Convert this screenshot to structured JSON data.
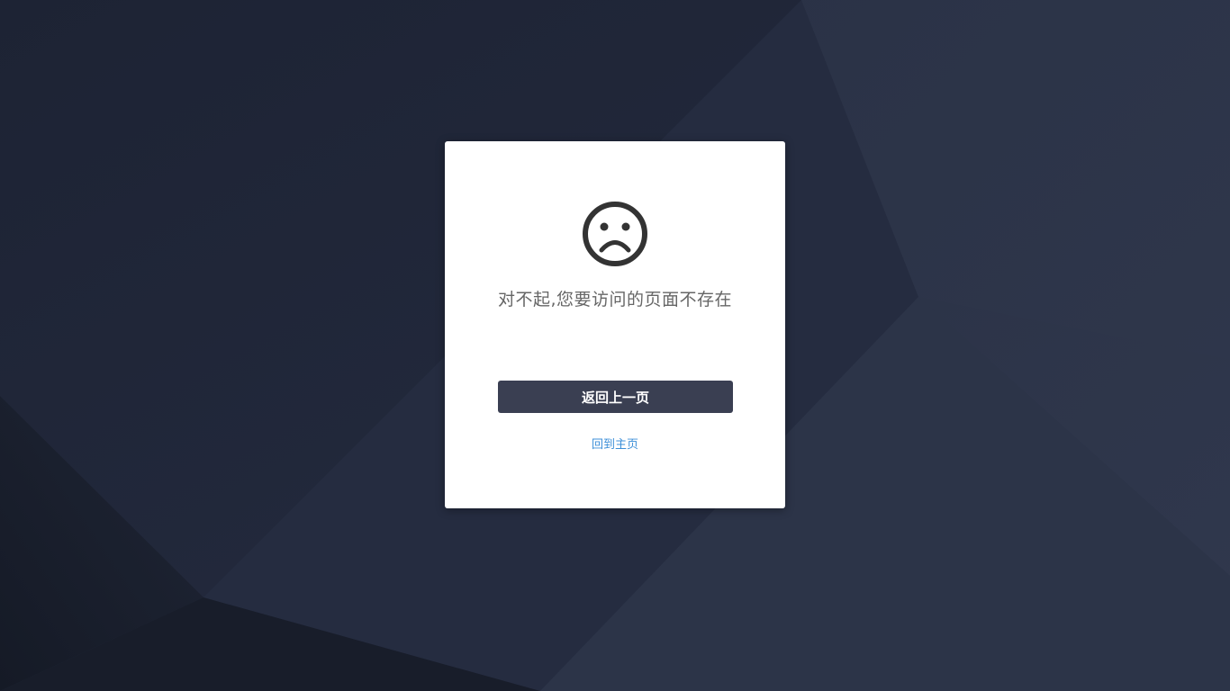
{
  "background": {
    "base_color": "#20263a"
  },
  "error_card": {
    "icon": "sad-face-icon",
    "message": "对不起,您要访问的页面不存在",
    "back_button_label": "返回上一页",
    "home_link_label": "回到主页",
    "accent_color": "#3c8fd8",
    "button_color": "#3a3f52"
  }
}
